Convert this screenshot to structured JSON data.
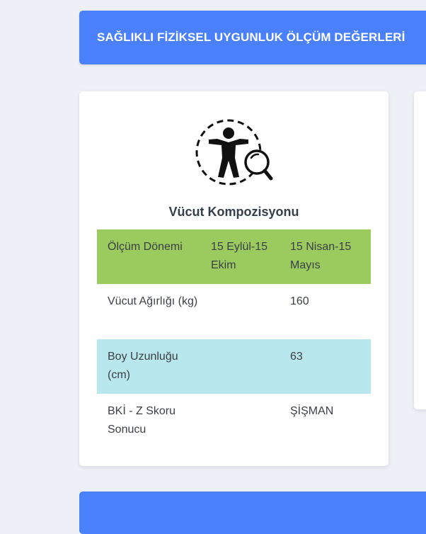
{
  "banner": {
    "title": "SAĞLIKLI FİZİKSEL UYGUNLUK ÖLÇÜM DEĞERLERİ"
  },
  "card": {
    "icon": "body-composition-icon",
    "title": "Vücut Kompozisyonu",
    "table": {
      "header": {
        "label": "Ölçüm Dönemi",
        "period1": "15 Eylül-15 Ekim",
        "period2": "15 Nisan-15 Mayıs"
      },
      "rows": [
        {
          "label": "Vücut Ağırlığı (kg)",
          "value1": "",
          "value2": "160"
        },
        {
          "label": "Boy Uzunluğu (cm)",
          "value1": "",
          "value2": "63"
        },
        {
          "label": "BKİ - Z Skoru Sonucu",
          "value1": "",
          "value2": "ŞİŞMAN"
        }
      ]
    }
  },
  "colors": {
    "accent": "#4a80fa",
    "header_row": "#9bcb5f",
    "striped_row": "#b9e7ee",
    "background": "#eef0f7"
  }
}
